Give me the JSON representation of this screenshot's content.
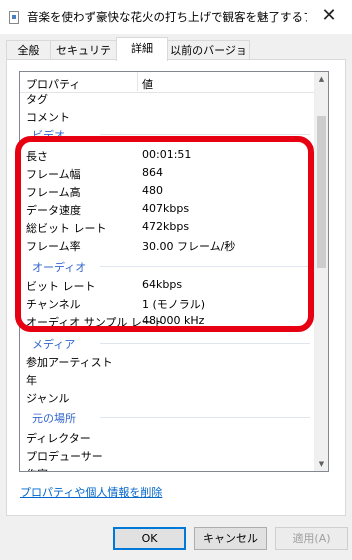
{
  "window": {
    "title": "音楽を使わず豪快な花火の打ち上げで観客を魅了するフィナーレシ...",
    "close_glyph": "✕"
  },
  "tabs": [
    "全般",
    "セキュリティ",
    "詳細",
    "以前のバージョン"
  ],
  "active_tab": "詳細",
  "list": {
    "header": {
      "property": "プロパティ",
      "value": "値"
    },
    "rows_top": [
      {
        "k": "タグ",
        "v": ""
      },
      {
        "k": "コメント",
        "v": ""
      }
    ],
    "group_video": "ビデオ",
    "video_rows": [
      {
        "k": "長さ",
        "v": "00:01:51"
      },
      {
        "k": "フレーム幅",
        "v": "864"
      },
      {
        "k": "フレーム高",
        "v": "480"
      },
      {
        "k": "データ速度",
        "v": "407kbps"
      },
      {
        "k": "総ビット レート",
        "v": "472kbps"
      },
      {
        "k": "フレーム率",
        "v": "30.00 フレーム/秒"
      }
    ],
    "group_audio": "オーディオ",
    "audio_rows": [
      {
        "k": "ビット レート",
        "v": "64kbps"
      },
      {
        "k": "チャンネル",
        "v": "1 (モノラル)"
      },
      {
        "k": "オーディオ サンプル レート",
        "v": "48.000 kHz"
      }
    ],
    "group_media": "メディア",
    "media_rows": [
      {
        "k": "参加アーティスト",
        "v": ""
      },
      {
        "k": "年",
        "v": ""
      },
      {
        "k": "ジャンル",
        "v": ""
      }
    ],
    "group_origin": "元の場所",
    "origin_rows": [
      {
        "k": "ディレクター",
        "v": ""
      },
      {
        "k": "プロデューサー",
        "v": ""
      },
      {
        "k": "作家",
        "v": ""
      }
    ]
  },
  "remove_link": "プロパティや個人情報を削除",
  "buttons": {
    "ok": "OK",
    "cancel": "キャンセル",
    "apply": "適用(A)"
  },
  "colors": {
    "highlight": "#e60012",
    "group_text": "#3366cc",
    "link": "#0066cc",
    "ok_border": "#0078d7"
  }
}
